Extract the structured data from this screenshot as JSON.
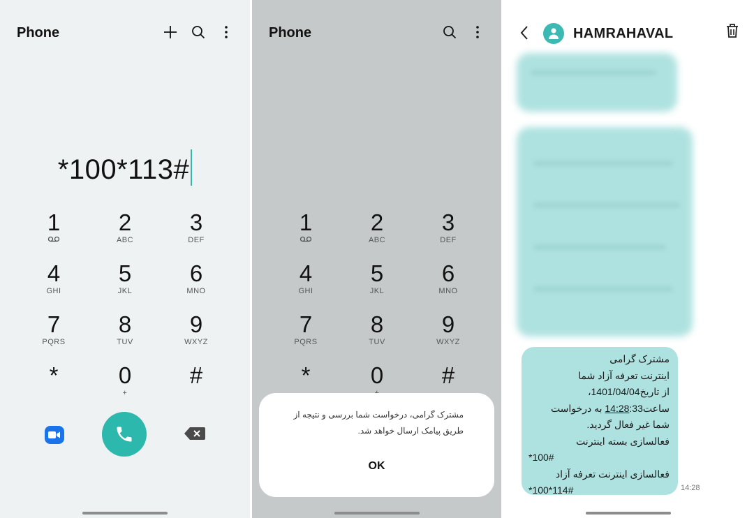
{
  "panel1": {
    "title": "Phone",
    "dialed": "*100*113#",
    "keys": [
      {
        "digit": "1",
        "letters": ""
      },
      {
        "digit": "2",
        "letters": "ABC"
      },
      {
        "digit": "3",
        "letters": "DEF"
      },
      {
        "digit": "4",
        "letters": "GHI"
      },
      {
        "digit": "5",
        "letters": "JKL"
      },
      {
        "digit": "6",
        "letters": "MNO"
      },
      {
        "digit": "7",
        "letters": "PQRS"
      },
      {
        "digit": "8",
        "letters": "TUV"
      },
      {
        "digit": "9",
        "letters": "WXYZ"
      },
      {
        "digit": "*",
        "letters": ""
      },
      {
        "digit": "0",
        "letters": "+"
      },
      {
        "digit": "#",
        "letters": ""
      }
    ],
    "accent_color": "#2db8ad"
  },
  "panel2": {
    "title": "Phone",
    "dialog": {
      "message": "مشترک گرامی، درخواست شما بررسی و نتیجه از طریق پیامک ارسال خواهد شد.",
      "ok_label": "OK"
    }
  },
  "panel3": {
    "contact_name": "HAMRAHAVAL",
    "message": {
      "line1": "مشترک گرامی",
      "line2": "اینترنت تعرفه آزاد شما",
      "line3_text": "از تاریخ",
      "line3_date": "1401/04/04",
      "line4_prefix": "ساعت",
      "line4_time_a": "14:28",
      "line4_time_b": ":33",
      "line4_suffix": "به درخواست",
      "line5": "شما غیر فعال گردید.",
      "line6": "فعالسازی بسته اینترنت",
      "line7": "*100#",
      "line8": "فعالسازی اینترنت تعرفه آزاد",
      "line9": "*100*114#"
    },
    "time": "14:28"
  }
}
